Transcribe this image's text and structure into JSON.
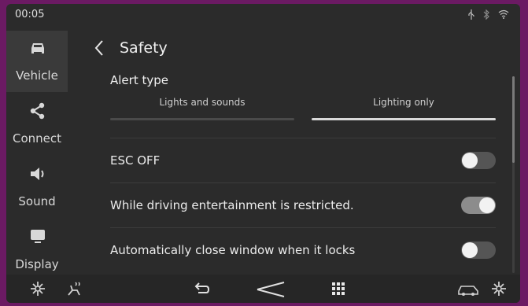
{
  "status": {
    "time": "00:05",
    "icons": [
      "usb-icon",
      "bluetooth-icon",
      "wifi-icon"
    ]
  },
  "sidebar": {
    "items": [
      {
        "label": "Vehicle",
        "icon": "car-icon",
        "active": true
      },
      {
        "label": "Connect",
        "icon": "share-icon",
        "active": false
      },
      {
        "label": "Sound",
        "icon": "speaker-icon",
        "active": false
      },
      {
        "label": "Display",
        "icon": "monitor-icon",
        "active": false
      }
    ]
  },
  "header": {
    "title": "Safety",
    "back_icon": "chevron-left-icon"
  },
  "alert": {
    "title": "Alert type",
    "options": [
      {
        "label": "Lights and sounds",
        "selected": false
      },
      {
        "label": "Lighting only",
        "selected": true
      }
    ]
  },
  "settings": [
    {
      "label": "ESC OFF",
      "enabled": false
    },
    {
      "label": "While driving entertainment is restricted.",
      "enabled": true
    },
    {
      "label": "Automatically close window when it locks",
      "enabled": false
    }
  ],
  "bottom_bar": {
    "icons": [
      "fan-icon",
      "seat-heat-icon",
      "back-icon",
      "home-icon",
      "apps-grid-icon",
      "car-mode-icon",
      "fan-right-icon"
    ]
  },
  "colors": {
    "bezel": "#6b1a63",
    "screen": "#2b2b2b",
    "toggle_on": "#8c8c8c",
    "toggle_off": "#555555",
    "selected_bar": "#d9d9d9"
  }
}
